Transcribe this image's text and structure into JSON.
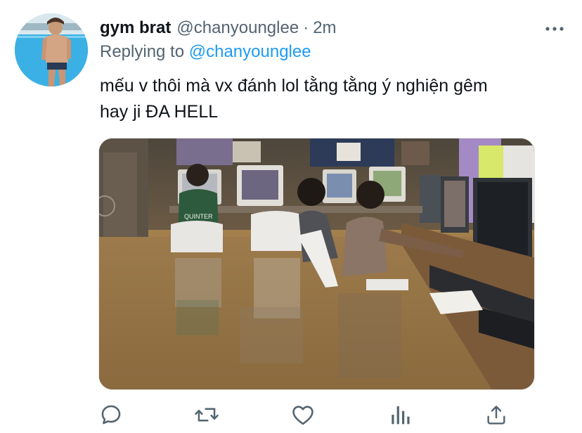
{
  "tweet": {
    "display_name": "gym brat",
    "handle": "@chanyounglee",
    "separator": "·",
    "time": "2m",
    "reply_prefix": "Replying to",
    "reply_mention": "@chanyounglee",
    "text_line1": "mếu v thôi mà vx đánh lol tằng tằng ý nghiện gêm",
    "text_line2": "hay ji ĐA HELL"
  },
  "media": {
    "jersey_text": "QUINTER"
  },
  "icons": {
    "more": "more-horizontal-icon",
    "reply": "reply-icon",
    "retweet": "retweet-icon",
    "like": "heart-icon",
    "analytics": "analytics-icon",
    "share": "share-icon"
  },
  "colors": {
    "text": "#0f1419",
    "secondary": "#536471",
    "link": "#1d9bf0"
  }
}
